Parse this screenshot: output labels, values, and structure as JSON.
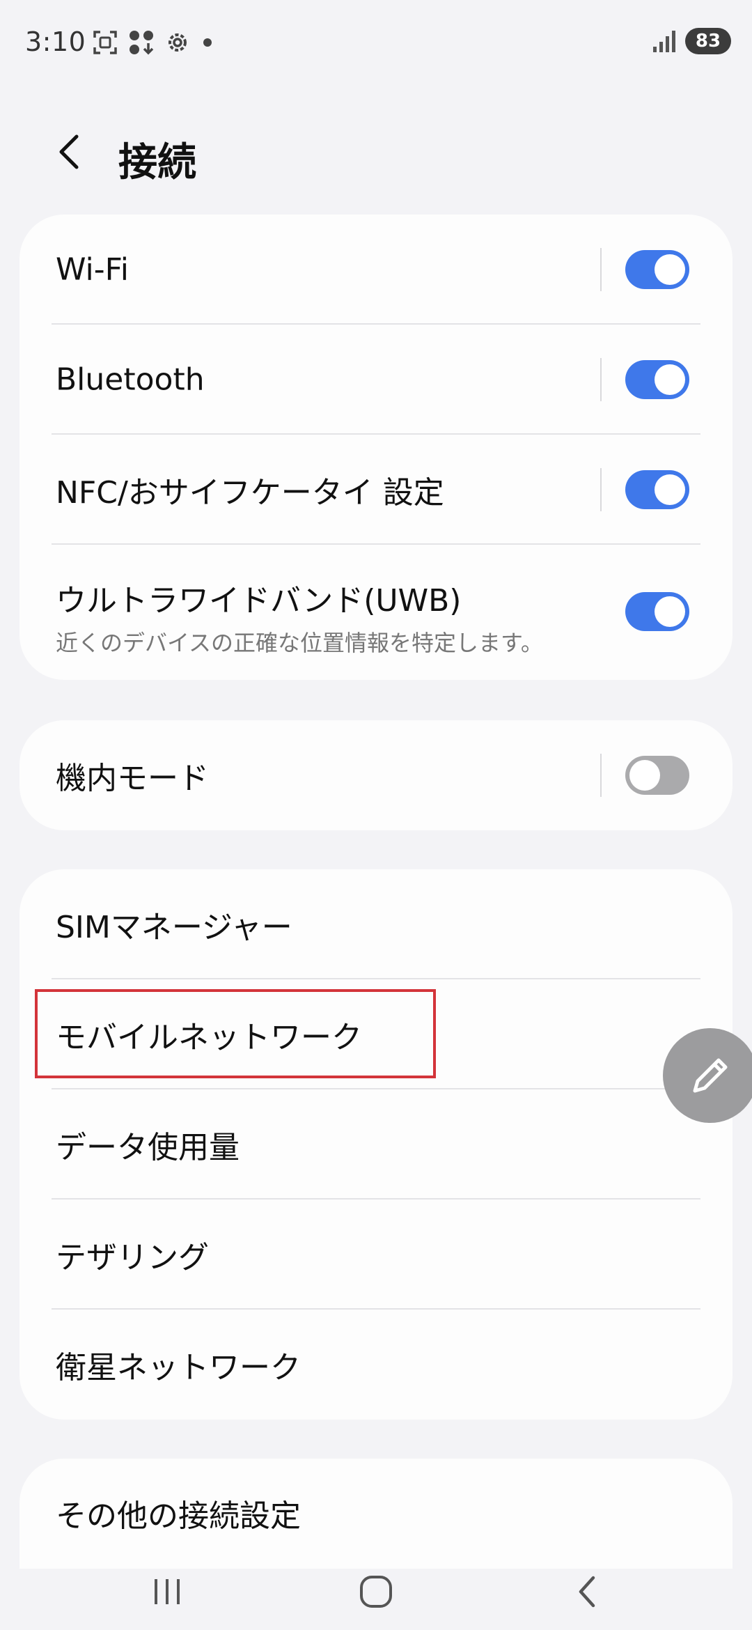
{
  "status_bar": {
    "time": "3:10",
    "battery": "83",
    "icons": [
      "screenshot-icon",
      "download-icon",
      "settings-gear-icon",
      "dot-icon",
      "signal-icon"
    ]
  },
  "header": {
    "title": "接続",
    "back_icon": "chevron-left-icon"
  },
  "toggles_card": {
    "items": [
      {
        "label": "Wi-Fi",
        "on": true
      },
      {
        "label": "Bluetooth",
        "on": true
      },
      {
        "label": "NFC/おサイフケータイ 設定",
        "on": true
      },
      {
        "label": "ウルトラワイドバンド(UWB)",
        "description": "近くのデバイスの正確な位置情報を特定します。",
        "on": true
      }
    ]
  },
  "airplane_card": {
    "label": "機内モード",
    "on": false
  },
  "network_card": {
    "items": [
      {
        "label": "SIMマネージャー"
      },
      {
        "label": "モバイルネットワーク",
        "highlighted": true
      },
      {
        "label": "データ使用量"
      },
      {
        "label": "テザリング"
      },
      {
        "label": "衛星ネットワーク"
      }
    ]
  },
  "more_card": {
    "label": "その他の接続設定"
  },
  "fab": {
    "icon": "edit-pencil-icon"
  },
  "nav_bar": {
    "icons": [
      "recent-apps-icon",
      "home-icon",
      "back-icon"
    ]
  },
  "colors": {
    "toggle_on": "#3f78ea",
    "toggle_off": "#aaaaac",
    "highlight": "#d3343a",
    "background": "#f3f3f6"
  }
}
